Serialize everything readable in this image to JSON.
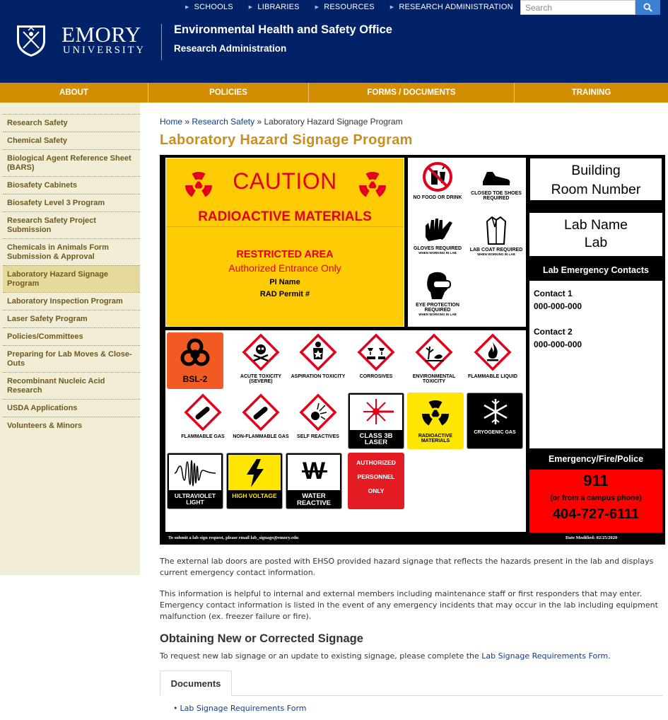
{
  "header": {
    "top_links": [
      "SCHOOLS",
      "LIBRARIES",
      "RESOURCES",
      "RESEARCH ADMINISTRATION"
    ],
    "search_placeholder": "Search",
    "logo_emory": "EMORY",
    "logo_university": "UNIVERSITY",
    "office_title": "Environmental Health and Safety Office",
    "office_subtitle": "Research Administration"
  },
  "nav": [
    "ABOUT",
    "POLICIES",
    "FORMS / DOCUMENTS",
    "TRAINING"
  ],
  "sidebar": {
    "items": [
      "Research Safety",
      "Chemical Safety",
      "Biological Agent Reference Sheet (BARS)",
      "Biosafety Cabinets",
      "Biosafety Level 3 Program",
      "Research Safety Project Submission",
      "Chemicals in Animals Form Submission & Approval",
      "Laboratory Hazard Signage Program",
      "Laboratory Inspection Program",
      "Laser Safety Program",
      "Policies/Committees",
      "Preparing for Lab Moves & Close-Outs",
      "Recombinant Nucleic Acid Research",
      "USDA Applications",
      "Volunteers & Minors"
    ],
    "active_index": 7
  },
  "breadcrumb": {
    "home": "Home",
    "sep": "»",
    "research_safety": "Research Safety",
    "current": "Laboratory Hazard Signage Program"
  },
  "page_title": "Laboratory Hazard Signage Program",
  "sign": {
    "caution": "CAUTION",
    "radioactive_materials": "RADIOACTIVE MATERIALS",
    "restricted_area": "RESTRICTED AREA",
    "authorized": "Authorized Entrance Only",
    "pi_name": "PI Name",
    "rad_permit": "RAD Permit #",
    "ppe": [
      {
        "label": "NO FOOD OR DRINK",
        "sub": "",
        "icon": "no-food-drink-icon"
      },
      {
        "label": "CLOSED TOE SHOES REQUIRED",
        "sub": "",
        "icon": "shoe-icon"
      },
      {
        "label": "GLOVES REQUIRED",
        "sub": "WHEN WORKING IN LAB",
        "icon": "gloves-icon"
      },
      {
        "label": "LAB COAT REQUIRED",
        "sub": "WHEN WORKING IN LAB",
        "icon": "lab-coat-icon"
      },
      {
        "label": "EYE PROTECTION REQUIRED",
        "sub": "WHEN WORKING IN LAB",
        "icon": "goggles-icon"
      }
    ],
    "bsl": "BSL-2",
    "ghs": [
      {
        "label": "ACUTE TOXICITY (SEVERE)",
        "icon": "skull-icon"
      },
      {
        "label": "ASPIRATION TOXICITY",
        "icon": "health-hazard-icon"
      },
      {
        "label": "CORROSIVES",
        "icon": "corrosive-icon"
      },
      {
        "label": "ENVIRONMENTAL TOXICITY",
        "icon": "environment-icon"
      },
      {
        "label": "FLAMMABLE LIQUID",
        "icon": "flame-icon"
      },
      {
        "label": "FLAMMABLE GAS",
        "icon": "gas-cylinder-icon"
      },
      {
        "label": "NON-FLAMMABLE GAS",
        "icon": "gas-cylinder-icon"
      },
      {
        "label": "SELF REACTIVES",
        "icon": "exploding-bomb-icon"
      }
    ],
    "laser": "CLASS 3B LASER",
    "radio_small": "RADIOACTIVE MATERIALS",
    "cryo": "CRYOGENIC GAS",
    "uv": "ULTRAVIOLET LIGHT",
    "high_voltage": "HIGH VOLTAGE",
    "water_reactive": "WATER REACTIVE",
    "water_letter": "W",
    "authorized_personnel": [
      "AUTHORIZED",
      "PERSONNEL",
      "ONLY"
    ],
    "footer_left": "To submit a lab sign request, please email lab_signage@emory.edu",
    "footer_right": "Date Modified: 02/25/2020",
    "building": "Building",
    "room_number": "Room Number",
    "lab_name": "Lab Name",
    "lab": "Lab",
    "contacts_header": "Lab Emergency Contacts",
    "contact1": "Contact 1",
    "contact1_phone": "000-000-000",
    "contact2": "Contact 2",
    "contact2_phone": "000-000-000",
    "emergency_header": "Emergency/Fire/Police",
    "e911": "911",
    "campus_phone": "(or from a campus phone)",
    "emergency_number": "404-727-6111"
  },
  "content": {
    "p1": "The external lab doors are posted with EHSO provided hazard signage that reflects the hazards present in the lab and displays current emergency contact information.",
    "p2": "This information is helpful to internal and external members including maintenance staff or first responders that may enter. Emergency contact information is listed in the event of any emergency incidents that may occur in the lab including equipment malfunction (ex. freezer failure or fire).",
    "h_obtaining": "Obtaining New or Corrected Signage",
    "p3_before": "To request new lab signage or an update to existing signage, please complete the ",
    "p3_link": "Lab Signage Requirements Form",
    "p3_after": ".",
    "tab_documents": "Documents",
    "doc_link": "Lab Signage Requirements Form"
  },
  "colors": {
    "header_blue": "#012169",
    "nav_gold": "#d28e00",
    "title_gold": "#c8901a",
    "caution_yellow": "#ffcb05",
    "caution_red": "#e3001b"
  }
}
